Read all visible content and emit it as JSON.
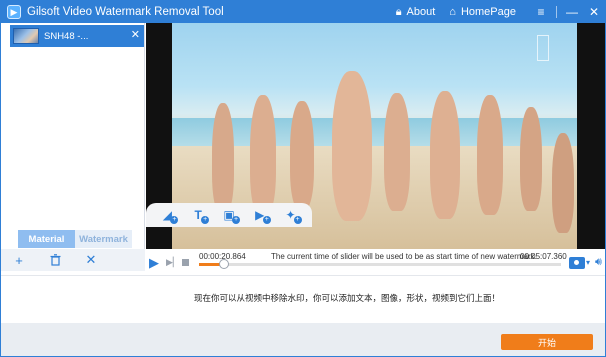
{
  "titlebar": {
    "app_title": "Gilsoft Video Watermark Removal Tool",
    "about_label": "About",
    "homepage_label": "HomePage"
  },
  "file_list": {
    "items": [
      {
        "name": "SNH48 -..."
      }
    ]
  },
  "tabs": [
    {
      "label": "Material",
      "active": true
    },
    {
      "label": "Watermark",
      "active": false
    }
  ],
  "playback": {
    "start_time": "00:00:20.864",
    "message": "The current time of slider will be used to be as start time of new watermark.",
    "end_time": "00:05:07.360",
    "progress": 0.068
  },
  "info_text": "现在你可以从视频中移除水印，你可以添加文本，图像，形状，视频到它们上面！",
  "start_button_label": "开始",
  "colors": {
    "accent": "#2f7fd6",
    "action": "#f07d1a"
  },
  "icons": {
    "toolbar": [
      "add-shape-icon",
      "add-text-icon",
      "add-image-icon",
      "add-video-icon",
      "add-effect-icon"
    ],
    "list_actions": [
      "add-icon",
      "trash-icon",
      "clear-icon"
    ]
  }
}
